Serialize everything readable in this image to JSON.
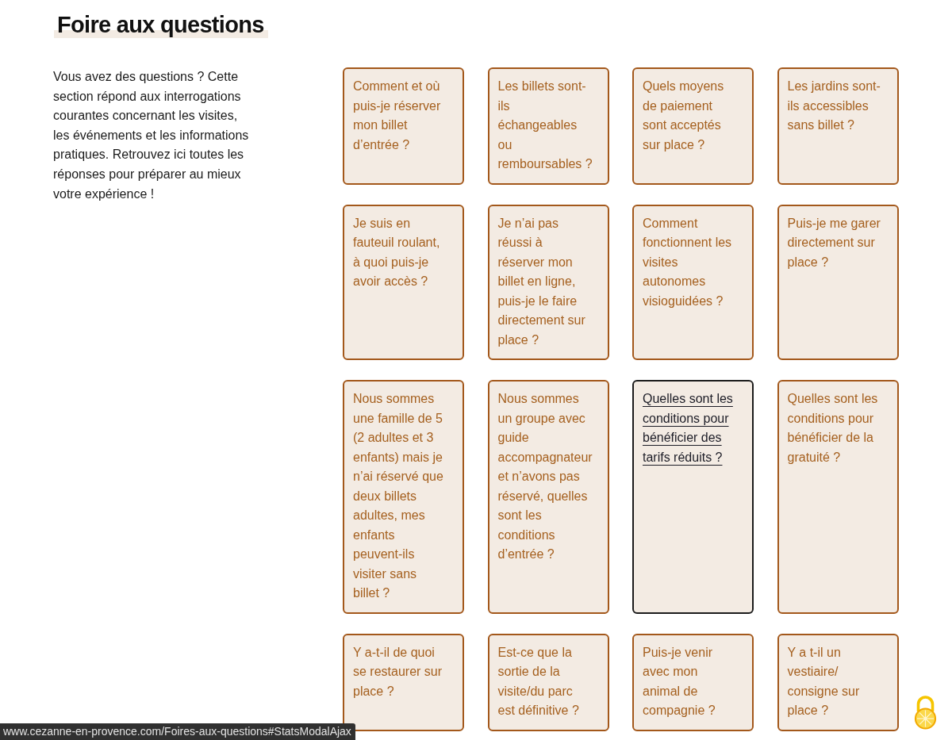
{
  "page": {
    "title": "Foire aux questions",
    "intro": "Vous avez des questions ? Cette section répond aux interrogations courantes concernant les visites, les événements et les informations pratiques. Retrouvez ici toutes les réponses pour préparer au mieux votre expérience !"
  },
  "faq": {
    "cards": [
      {
        "question": "Comment et où puis-je réserver mon billet d’entrée ?",
        "hovered": false
      },
      {
        "question": "Les billets sont-ils échangeables ou remboursables ?",
        "hovered": false
      },
      {
        "question": "Quels moyens de paiement sont acceptés sur place ?",
        "hovered": false
      },
      {
        "question": "Les jardins sont-ils accessibles sans billet ?",
        "hovered": false
      },
      {
        "question": "Je suis en fauteuil roulant, à quoi puis-je avoir accès ?",
        "hovered": false
      },
      {
        "question": "Je n’ai pas réussi à réserver mon billet en ligne, puis-je le faire directement sur place ?",
        "hovered": false
      },
      {
        "question": "Comment fonctionnent les visites autonomes visioguidées ?",
        "hovered": false
      },
      {
        "question": "Puis-je me garer directement sur place ?",
        "hovered": false
      },
      {
        "question": "Nous sommes une famille de 5 (2 adultes et 3 enfants) mais je n’ai réservé que deux billets adultes, mes enfants peuvent-ils visiter sans billet ?",
        "hovered": false
      },
      {
        "question": "Nous sommes un groupe avec guide accompagnateur et n’avons pas réservé, quelles sont les conditions d’entrée ?",
        "hovered": false
      },
      {
        "question": "Quelles sont les conditions pour bénéficier des tarifs réduits ?",
        "hovered": true
      },
      {
        "question": "Quelles sont les conditions pour bénéficier de la gratuité ?",
        "hovered": false
      },
      {
        "question": "Y a-t-il de quoi se restaurer sur place ?",
        "hovered": false
      },
      {
        "question": "Est-ce que la sortie de la visite/du parc est définitive ?",
        "hovered": false
      },
      {
        "question": "Puis-je venir avec mon animal de compagnie ?",
        "hovered": false
      },
      {
        "question": "Y a t-il un vestiaire/consigne sur place ?",
        "hovered": false
      }
    ]
  },
  "status_bar": {
    "url": "www.cezanne-en-provence.com/Foires-aux-questions#StatsModalAjax"
  }
}
